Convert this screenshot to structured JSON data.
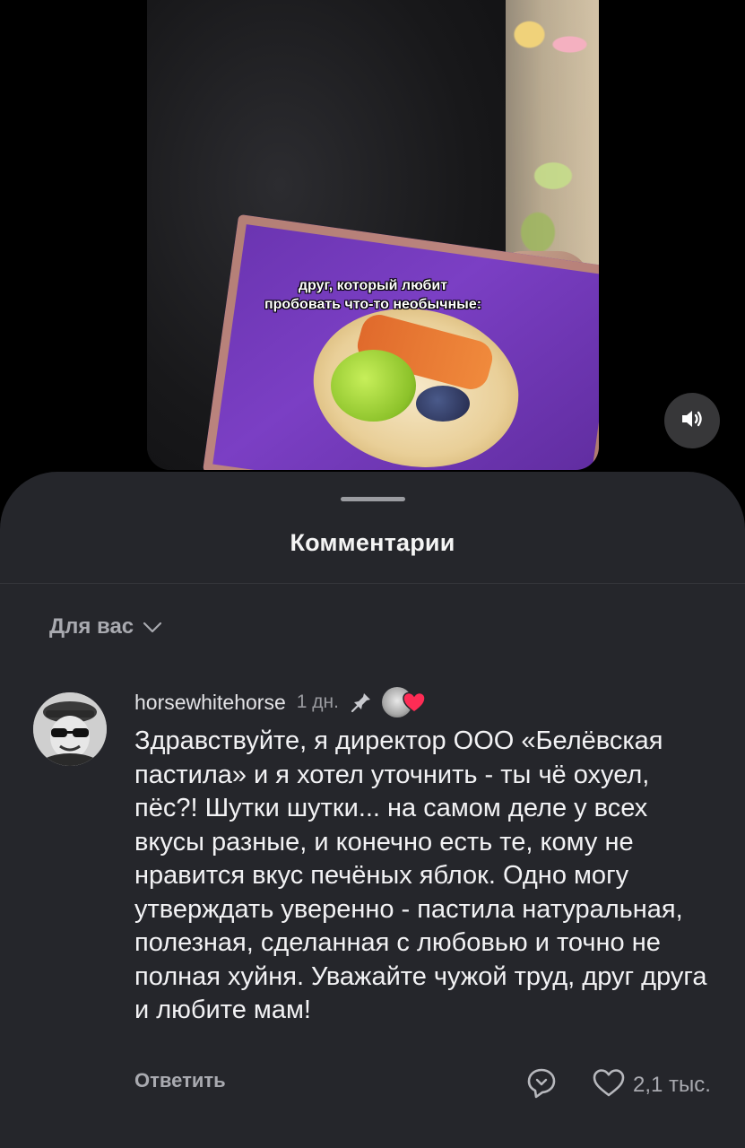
{
  "video": {
    "caption_line1": "друг, который любит",
    "caption_line2": "пробовать что-то необычные:",
    "sound_icon": "volume-icon"
  },
  "sheet": {
    "title": "Комментарии",
    "filter_label": "Для вас",
    "filter_icon": "chevron-down-icon"
  },
  "comment": {
    "username": "horsewhitehorse",
    "time": "1 дн.",
    "pin_icon": "pin-icon",
    "creator_like_icon": "heart-icon",
    "text": "Здравствуйте, я директор ООО «Белёвская пастила» и я хотел уточнить - ты чё охуел, пёс?! Шутки шутки... на самом деле у всех вкусы разные, и конечно есть те, кому не нравится вкус печёных яблок. Одно могу утверждать уверенно - пастила натуральная,  полезная, сделанная с любовью и точно не полная хуйня. Уважайте чужой труд, друг друга и любите мам!",
    "reply_label": "Ответить",
    "dislike_icon": "dislike-icon",
    "like_icon": "heart-outline-icon",
    "like_count": "2,1 тыс."
  },
  "colors": {
    "sheet_bg": "#25262b",
    "text_primary": "#f2f2f4",
    "text_secondary": "#a9aab0",
    "heart_red": "#fe2c55",
    "box_purple": "#6a34b0"
  }
}
